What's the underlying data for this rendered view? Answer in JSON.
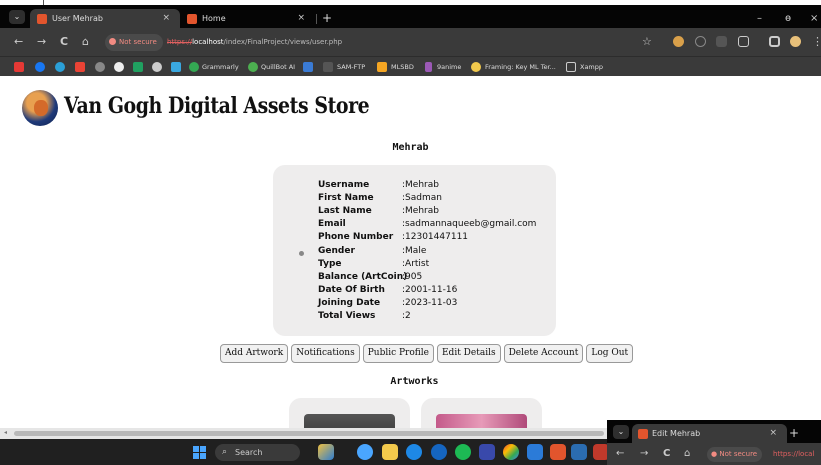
{
  "browser": {
    "tabs": [
      {
        "title": "User Mehrab",
        "active": true
      },
      {
        "title": "Home",
        "active": false
      }
    ],
    "tab_close": "×",
    "new_tab": "+",
    "window_controls": {
      "minimize": "–",
      "restore": "ɵ",
      "close": "×"
    },
    "nav": {
      "back": "←",
      "forward": "→",
      "reload": "C",
      "home": "⌂"
    },
    "security_label": "Not secure",
    "url_scheme": "https://",
    "url_host": "localhost",
    "url_path": "/index/FinalProject/views/user.php",
    "toolbar_star": "☆",
    "toolbar_more": "⋮",
    "bookmarks": [
      "Grammarly",
      "QuillBot AI",
      "SAM-FTP",
      "MLSBD",
      "9anime",
      "Framing: Key ML Ter...",
      "Xampp"
    ]
  },
  "page": {
    "site_title": "Van Gogh Digital Assets Store",
    "user_heading": "Mehrab",
    "profile": [
      {
        "label": "Username",
        "value": ":Mehrab"
      },
      {
        "label": "First Name",
        "value": ":Sadman"
      },
      {
        "label": "Last Name",
        "value": ":Mehrab"
      },
      {
        "label": "Email",
        "value": ":sadmannaqueeb@gmail.com"
      },
      {
        "label": "Phone Number",
        "value": ":12301447111"
      },
      {
        "label": "Gender",
        "value": ":Male"
      },
      {
        "label": "Type",
        "value": ":Artist"
      },
      {
        "label": "Balance (ArtCoin)",
        "value": ":905"
      },
      {
        "label": "Date Of Birth",
        "value": ":2001-11-16"
      },
      {
        "label": "Joining Date",
        "value": ":2023-11-03"
      },
      {
        "label": "Total Views",
        "value": ":2"
      }
    ],
    "actions": [
      "Add Artwork",
      "Notifications",
      "Public Profile",
      "Edit Details",
      "Delete Account",
      "Log Out"
    ],
    "artworks_heading": "Artworks"
  },
  "taskbar": {
    "search_placeholder": "Search"
  },
  "second_window": {
    "tab_title": "Edit Mehrab",
    "tab_close": "×",
    "new_tab": "+",
    "security_label": "Not secure",
    "url_partial": "https://local"
  },
  "colors": {
    "accent_brand_icon": "#e2552d",
    "card_background": "#eeeded",
    "dark_chrome": "#3a3a3a"
  }
}
